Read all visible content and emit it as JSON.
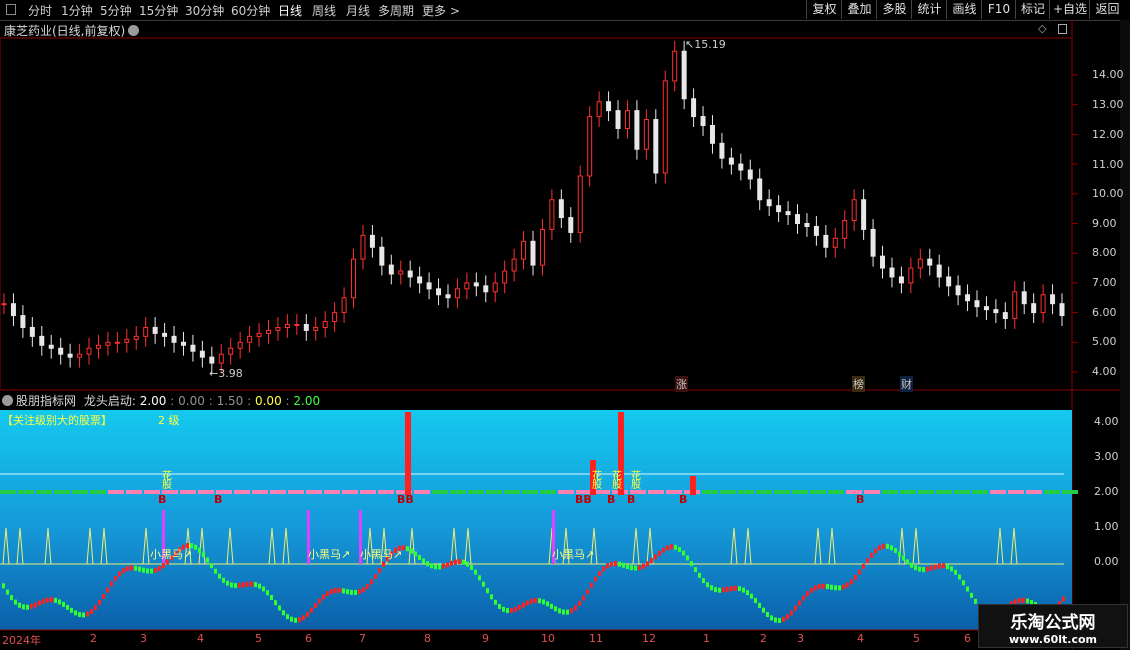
{
  "toolbar": {
    "timeframes": [
      "分时",
      "1分钟",
      "5分钟",
      "15分钟",
      "30分钟",
      "60分钟",
      "日线",
      "周线",
      "月线",
      "多周期",
      "更多 >"
    ],
    "active_timeframe": "日线",
    "tools": [
      "复权",
      "叠加",
      "多股",
      "统计",
      "画线",
      "F10",
      "标记",
      "+自选",
      "返回"
    ]
  },
  "main_chart": {
    "title": "康芝药业(日线,前复权)",
    "price_axis": [
      "14.00",
      "13.00",
      "12.00",
      "11.00",
      "10.00",
      "9.00",
      "8.00",
      "7.00",
      "6.00",
      "5.00",
      "4.00"
    ],
    "high_label": "15.19",
    "low_label": "3.98",
    "events": [
      {
        "text": "涨",
        "color": "#ff4040"
      },
      {
        "text": "榜",
        "color": "#ff9900"
      },
      {
        "text": "财",
        "color": "#6aa0ff"
      }
    ]
  },
  "indicator": {
    "name": "股朋指标网",
    "label": "龙头启动:",
    "values": [
      "2.00",
      "0.00",
      "1.50",
      "0.00",
      "2.00"
    ],
    "value_colors": [
      "#ffffff",
      "#909090",
      "#909090",
      "#ffff40",
      "#40ff40"
    ],
    "banner": "【关注级别大的股票】",
    "level": "2 级",
    "axis": [
      "4.00",
      "3.00",
      "2.00",
      "1.00",
      "0.00"
    ],
    "markers": [
      "小黑马↗",
      "小黑马↗",
      "小黑马↗",
      "小黑马↗"
    ],
    "bb": "BB",
    "b": "B",
    "flower": "花股"
  },
  "x_axis": {
    "labels": [
      "2024年",
      "2",
      "3",
      "4",
      "5",
      "6",
      "7",
      "8",
      "9",
      "10",
      "11",
      "12",
      "1",
      "2",
      "3",
      "4",
      "5",
      "6"
    ]
  },
  "watermark": {
    "name": "乐淘公式网",
    "url": "www.60lt.com"
  },
  "chart_data": {
    "type": "line",
    "title": "康芝药业(日线,前复权)",
    "ylim": [
      3.6,
      16.2
    ],
    "y": [
      6.3,
      5.9,
      5.5,
      5.2,
      4.9,
      4.8,
      4.6,
      4.5,
      4.6,
      4.8,
      4.9,
      5.0,
      5.0,
      5.1,
      5.2,
      5.5,
      5.3,
      5.2,
      5.0,
      4.9,
      4.7,
      4.5,
      4.3,
      4.6,
      4.8,
      5.0,
      5.2,
      5.3,
      5.4,
      5.5,
      5.6,
      5.6,
      5.4,
      5.5,
      5.7,
      6.0,
      6.5,
      7.8,
      8.6,
      8.2,
      7.6,
      7.3,
      7.4,
      7.2,
      7.0,
      6.8,
      6.6,
      6.5,
      6.8,
      7.0,
      6.9,
      6.7,
      7.0,
      7.4,
      7.8,
      8.4,
      7.6,
      8.8,
      9.8,
      9.2,
      8.7,
      10.6,
      12.6,
      13.1,
      12.8,
      12.2,
      12.8,
      11.5,
      12.5,
      10.7,
      13.8,
      14.8,
      13.2,
      12.6,
      12.3,
      11.7,
      11.2,
      11.0,
      10.8,
      10.5,
      9.8,
      9.6,
      9.4,
      9.3,
      9.0,
      8.9,
      8.6,
      8.2,
      8.5,
      9.1,
      9.8,
      8.8,
      7.9,
      7.5,
      7.2,
      7.0,
      7.5,
      7.8,
      7.6,
      7.2,
      6.9,
      6.6,
      6.4,
      6.2,
      6.1,
      6.0,
      5.8,
      6.7,
      6.3,
      6.0,
      6.6,
      6.3,
      5.9
    ]
  }
}
